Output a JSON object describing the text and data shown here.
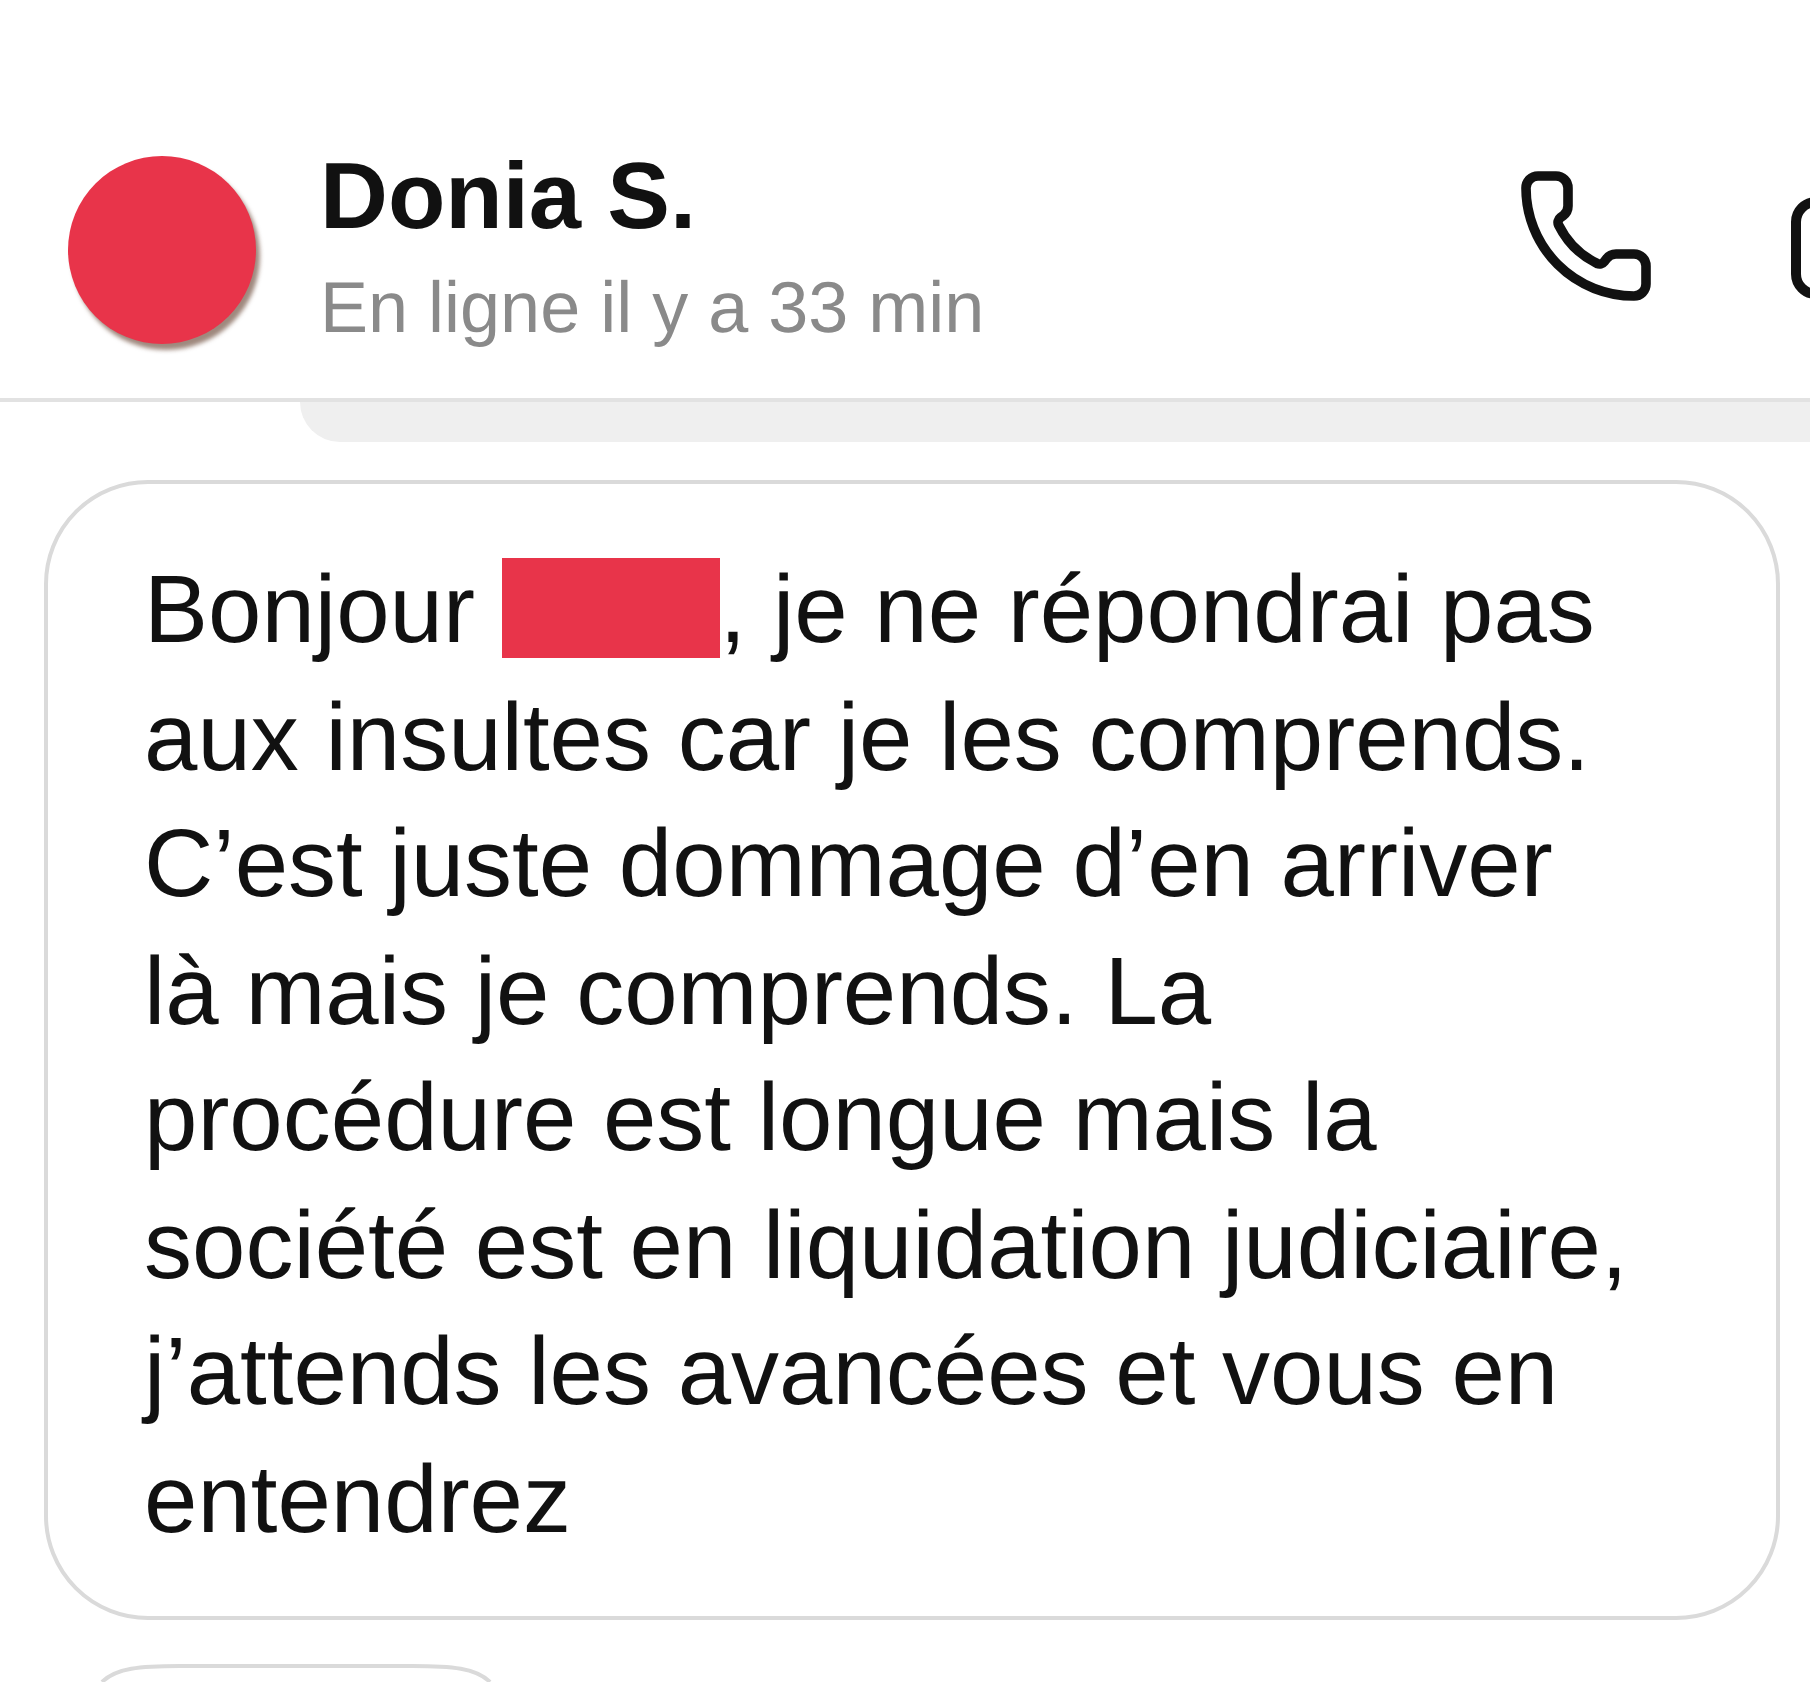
{
  "contact": {
    "name": "Donia S.",
    "status": "En ligne il y a 33 min"
  },
  "message": {
    "segments": [
      {
        "kind": "text",
        "text": "Bonjour "
      },
      {
        "kind": "redaction"
      },
      {
        "kind": "text",
        "text": ", je ne répondrai pas\naux insultes car je les comprends.\nC’est juste dommage d’en arriver\nlà mais je comprends. La\nprocédure est longue mais la\nsociété est en liquidation judiciaire,\nj’attends les avancées et vous en\nentendrez"
      }
    ]
  }
}
